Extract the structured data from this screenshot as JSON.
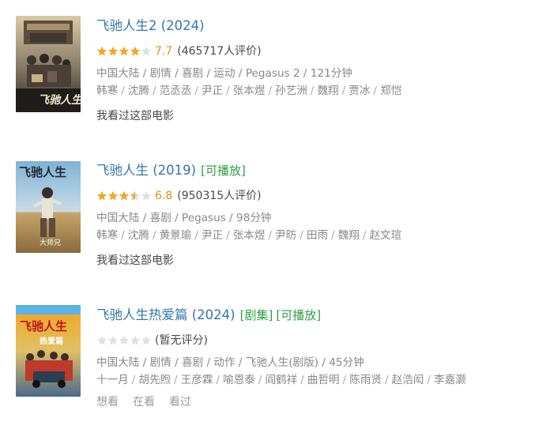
{
  "results": [
    {
      "title": "飞驰人生2 (2024)",
      "tags": [],
      "stars": 4,
      "score": "7.7",
      "votes": "(465717人评价)",
      "meta": "中国大陆 / 剧情 / 喜剧 / 运动 / Pegasus 2 / 121分钟",
      "cast": [
        "韩寒",
        "沈腾",
        "范丞丞",
        "尹正",
        "张本煜",
        "孙艺洲",
        "魏翔",
        "贾冰",
        "郑恺"
      ],
      "actions": [
        "我看过这部电影"
      ]
    },
    {
      "title": "飞驰人生 (2019)",
      "tags": [
        "[可播放]"
      ],
      "stars": 3.5,
      "score": "6.8",
      "votes": "(950315人评价)",
      "meta": "中国大陆 / 喜剧 / Pegasus / 98分钟",
      "cast": [
        "韩寒",
        "沈腾",
        "黄景瑜",
        "尹正",
        "张本煜",
        "尹昉",
        "田雨",
        "魏翔",
        "赵文瑄"
      ],
      "actions": [
        "我看过这部电影"
      ]
    },
    {
      "title": "飞驰人生热爱篇 (2024)",
      "tags": [
        "[剧集]",
        "[可播放]"
      ],
      "stars": 0,
      "score": "",
      "votes": "(暂无评分)",
      "meta": "中国大陆 / 剧情 / 喜剧 / 动作 / 飞驰人生(剧版) / 45分钟",
      "cast": [
        "十一月",
        "胡先煦",
        "王彦霖",
        "喻恩泰",
        "阎鹤祥",
        "曲哲明",
        "陈雨贤",
        "赵浩闳",
        "李嘉灏"
      ],
      "actions": [
        "想看",
        "在看",
        "看过"
      ]
    }
  ],
  "poster_texts": {
    "p1": "飞驰人生2",
    "p2_title": "飞驰人生",
    "p2_sub": "大师兄",
    "p3_title": "飞驰人生",
    "p3_sub": "热爱篇"
  },
  "colors": {
    "link": "#3377aa",
    "tag_green": "#2f9e47",
    "star_gold": "#f5a623",
    "star_empty": "#e0e0e0",
    "score_orange": "#e09015",
    "meta_gray": "#888888"
  },
  "icons": {
    "star_full": "star-full-icon",
    "star_half": "star-half-icon",
    "star_empty": "star-empty-icon"
  }
}
